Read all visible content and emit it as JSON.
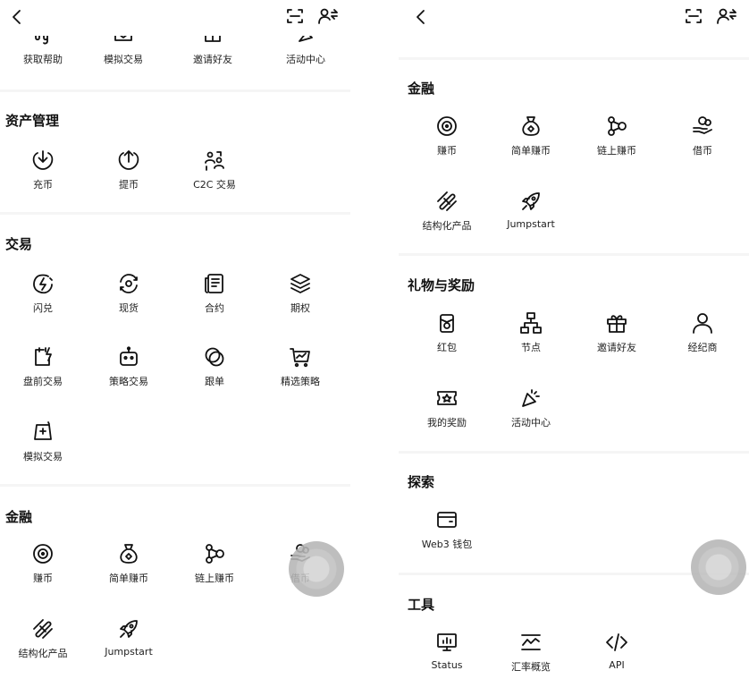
{
  "left": {
    "top_partial": [
      "获取帮助",
      "模拟交易",
      "邀请好友",
      "活动中心"
    ],
    "asset": {
      "title": "资产管理",
      "items": [
        "充币",
        "提币",
        "C2C 交易"
      ]
    },
    "trade": {
      "title": "交易",
      "items": [
        "闪兑",
        "现货",
        "合约",
        "期权",
        "盘前交易",
        "策略交易",
        "跟单",
        "精选策略",
        "模拟交易"
      ]
    },
    "finance": {
      "title": "金融",
      "items": [
        "赚币",
        "简单赚币",
        "链上赚币",
        "借币",
        "结构化产品",
        "Jumpstart"
      ]
    }
  },
  "right": {
    "finance": {
      "title": "金融",
      "items": [
        "赚币",
        "简单赚币",
        "链上赚币",
        "借币",
        "结构化产品",
        "Jumpstart"
      ]
    },
    "gifts": {
      "title": "礼物与奖励",
      "items": [
        "红包",
        "节点",
        "邀请好友",
        "经纪商",
        "我的奖励",
        "活动中心"
      ]
    },
    "explore": {
      "title": "探索",
      "items": [
        "Web3 钱包"
      ]
    },
    "tools": {
      "title": "工具",
      "items": [
        "Status",
        "汇率概览",
        "API"
      ]
    }
  },
  "icons": {
    "back": "chevron-left-icon",
    "scan": "scan-icon",
    "user": "user-switch-icon"
  }
}
